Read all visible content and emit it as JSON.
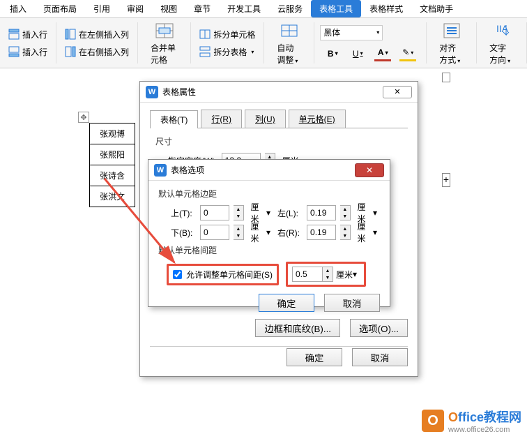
{
  "menubar": {
    "items": [
      "插入",
      "页面布局",
      "引用",
      "审阅",
      "视图",
      "章节",
      "开发工具",
      "云服务",
      "表格工具",
      "表格样式",
      "文档助手"
    ],
    "active_index": 8
  },
  "ribbon": {
    "insert_row_above": "插入行",
    "insert_col_left": "在左侧插入列",
    "insert_row_below": "插入行",
    "insert_col_right": "在右侧插入列",
    "merge_cells": "合并单元格",
    "split_cells": "拆分单元格",
    "split_table": "拆分表格",
    "auto_fit": "自动调整",
    "font_name": "黑体",
    "align": "对齐方式",
    "text_direction": "文字方向"
  },
  "doc_table": {
    "rows": [
      "张观博",
      "张熙阳",
      "张诗含",
      "张洪文"
    ]
  },
  "dlg_props": {
    "title": "表格属性",
    "close_hint": "✕",
    "tabs": [
      "表格(T)",
      "行(R)",
      "列(U)",
      "单元格(E)"
    ],
    "active_tab": 0,
    "size_label": "尺寸",
    "width_label": "指定宽度(W):",
    "width_value": "13.2",
    "width_unit": "厘米",
    "border_btn": "边框和底纹(B)...",
    "options_btn": "选项(O)...",
    "ok": "确定",
    "cancel": "取消"
  },
  "dlg_opts": {
    "title": "表格选项",
    "group_margin": "默认单元格边距",
    "top_label": "上(T):",
    "top_value": "0",
    "bottom_label": "下(B):",
    "bottom_value": "0",
    "left_label": "左(L):",
    "left_value": "0.19",
    "right_label": "右(R):",
    "right_value": "0.19",
    "unit": "厘米",
    "group_spacing": "默认单元格间距",
    "allow_spacing": "允许调整单元格间距(S)",
    "spacing_value": "0.5",
    "ok": "确定",
    "cancel": "取消"
  },
  "watermark": {
    "brand_o": "O",
    "brand_rest": "ffice教程网",
    "url": "www.office26.com"
  }
}
